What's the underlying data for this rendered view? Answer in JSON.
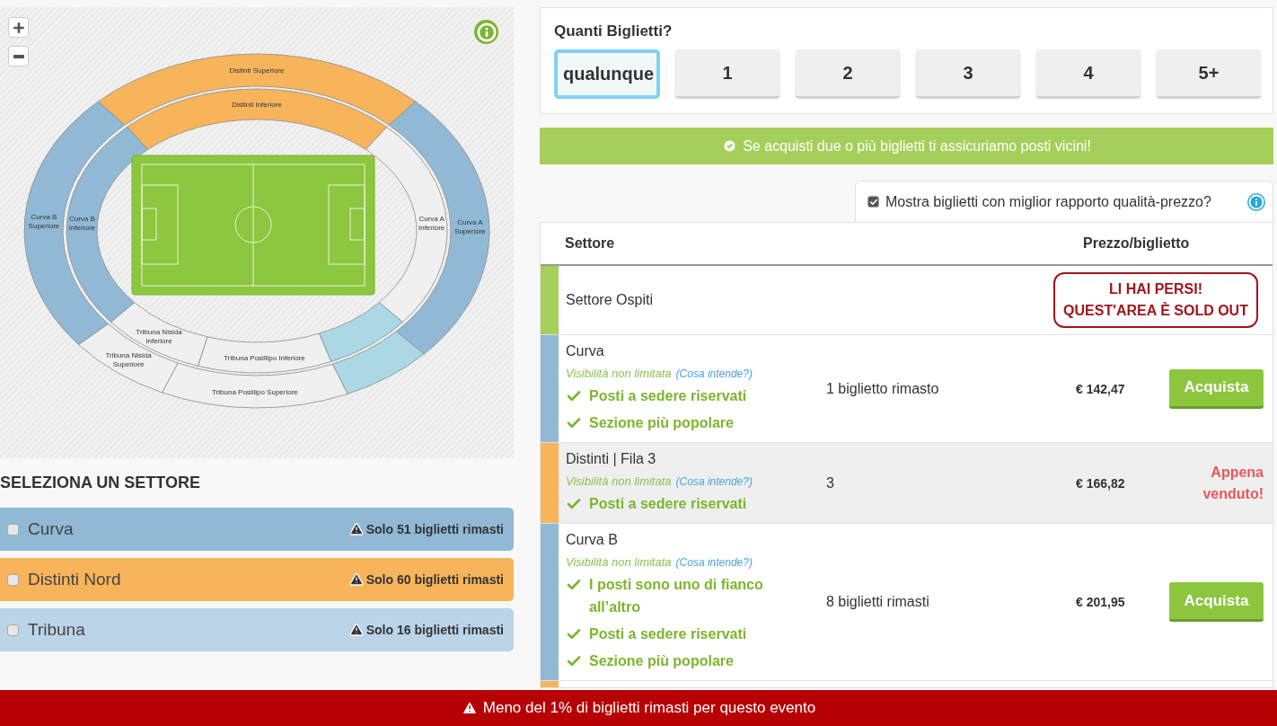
{
  "stadium_map": {
    "sectors": [
      {
        "lines": [
          "Distinti Superiore"
        ],
        "color": "#f8b45b"
      },
      {
        "lines": [
          "Distinti Inferiore"
        ],
        "color": "#f8b45b"
      },
      {
        "lines": [
          "Curva B",
          "Superiore"
        ],
        "color": "#91b9d5"
      },
      {
        "lines": [
          "Curva B",
          "Inferiore"
        ],
        "color": "#91b9d5"
      },
      {
        "lines": [
          "Curva A",
          "Inferiore"
        ],
        "color": "#f0f0f0"
      },
      {
        "lines": [
          "Curva A",
          "Superiore"
        ],
        "color": "#91b9d5"
      },
      {
        "lines": [
          "Tribuna Nisida",
          "Inferiore"
        ],
        "color": "#f0f0f0"
      },
      {
        "lines": [
          "Tribuna Nisida",
          "Superiore"
        ],
        "color": "#f0f0f0"
      },
      {
        "lines": [
          "Tribuna Posillipo Inferiore"
        ],
        "color": "#f0f0f0"
      },
      {
        "lines": [
          "Tribuna Posillipo Superiore"
        ],
        "color": "#f0f0f0"
      },
      {
        "color": "#acd8e6"
      },
      {
        "color": "#acd8e6"
      }
    ]
  },
  "sector_filter": {
    "title": "SELEZIONA UN SETTORE",
    "items": [
      {
        "label": "Curva",
        "note": "Solo 51 biglietti rimasti",
        "checked": false,
        "color": "#91b9d5"
      },
      {
        "label": "Distinti Nord",
        "note": "Solo 60 biglietti rimasti",
        "checked": false,
        "color": "#f8b45b"
      },
      {
        "label": "Tribuna",
        "note": "Solo 16 biglietti rimasti",
        "checked": false,
        "color": "#bcd4e8"
      }
    ]
  },
  "quantity": {
    "title": "Quanti Biglietti?",
    "options": [
      {
        "label": "qualunque",
        "selected": true
      },
      {
        "label": "1",
        "selected": false
      },
      {
        "label": "2",
        "selected": false
      },
      {
        "label": "3",
        "selected": false
      },
      {
        "label": "4",
        "selected": false
      },
      {
        "label": "5+",
        "selected": false
      }
    ]
  },
  "notice": "Se acquisti due o più biglietti ti assicuriamo posti vicini!",
  "best_value": {
    "label": "Mostra biglietti con miglior rapporto qualità-prezzo?",
    "checked": true
  },
  "table": {
    "columns": [
      "Settore",
      "Prezzo/biglietto"
    ],
    "rows": [
      {
        "kind": "soldout",
        "color": "#a5cf5a",
        "sector": "Settore Ospiti",
        "soldout_lines": [
          "LI HAI PERSI!",
          "QUEST'AREA È SOLD OUT"
        ]
      },
      {
        "kind": "buy",
        "color": "#91b9d5",
        "sector": "Curva",
        "visibility": "Visibilità non limitata",
        "info_link": "(Cosa intende?)",
        "features": [
          "Posti a sedere riservati",
          "Sezione più popolare"
        ],
        "availability": "1 biglietto rimasto",
        "price": "€ 142,47",
        "action": "Acquista"
      },
      {
        "kind": "sold",
        "color": "#f8b45b",
        "sector": "Distinti | Fila 3",
        "visibility": "Visibilità non limitata",
        "info_link": "(Cosa intende?)",
        "features": [
          "Posti a sedere riservati"
        ],
        "availability": "3",
        "price": "€ 166,82",
        "status": "Appena venduto!"
      },
      {
        "kind": "buy",
        "color": "#91b9d5",
        "sector": "Curva B",
        "visibility": "Visibilità non limitata",
        "info_link": "(Cosa intende?)",
        "features": [
          "I posti sono uno di fianco all’altro",
          "Posti a sedere riservati",
          "Sezione più popolare"
        ],
        "availability": "8 biglietti rimasti",
        "price": "€ 201,95",
        "action": "Acquista"
      },
      {
        "kind": "cut",
        "color": "#f8b45b"
      }
    ]
  },
  "footer": "Meno del 1% di biglietti rimasti per questo evento"
}
